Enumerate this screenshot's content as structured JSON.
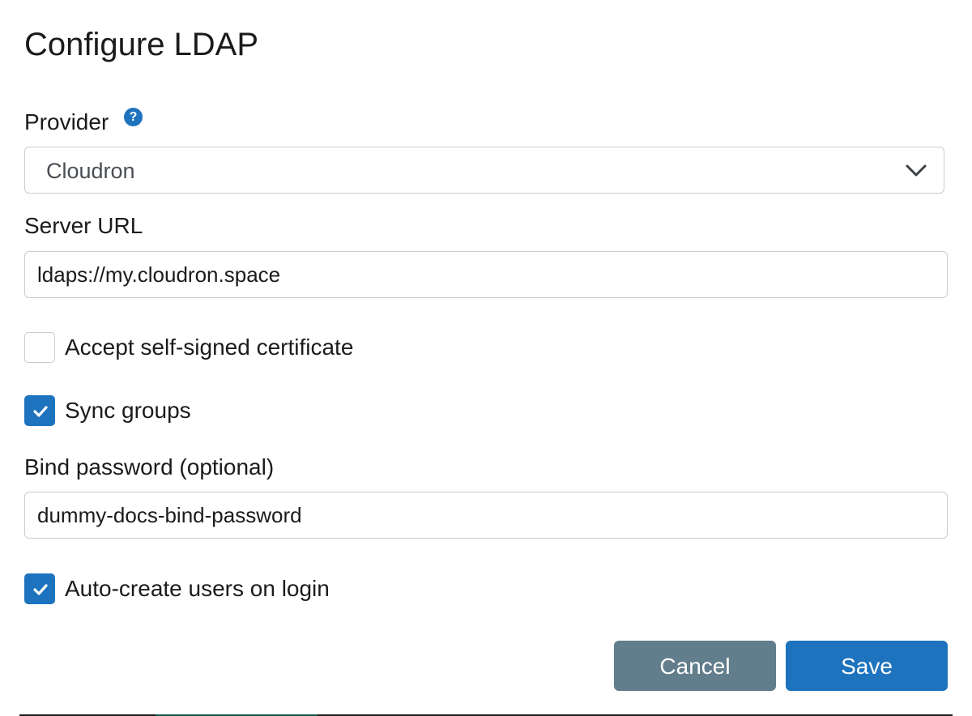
{
  "dialog": {
    "title": "Configure LDAP"
  },
  "provider": {
    "label": "Provider",
    "help_icon": "question-circle-icon",
    "selected": "Cloudron",
    "chevron_icon": "chevron-down-icon"
  },
  "server_url": {
    "label": "Server URL",
    "value": "ldaps://my.cloudron.space"
  },
  "checkboxes": {
    "accept_self_signed": {
      "label": "Accept self-signed certificate",
      "checked": false
    },
    "sync_groups": {
      "label": "Sync groups",
      "checked": true
    },
    "auto_create_users": {
      "label": "Auto-create users on login",
      "checked": true
    }
  },
  "bind_password": {
    "label": "Bind password (optional)",
    "value": "dummy-docs-bind-password"
  },
  "buttons": {
    "cancel": "Cancel",
    "save": "Save"
  },
  "colors": {
    "primary": "#1e73be",
    "secondary": "#627d8c",
    "border": "#c8ccd0"
  }
}
